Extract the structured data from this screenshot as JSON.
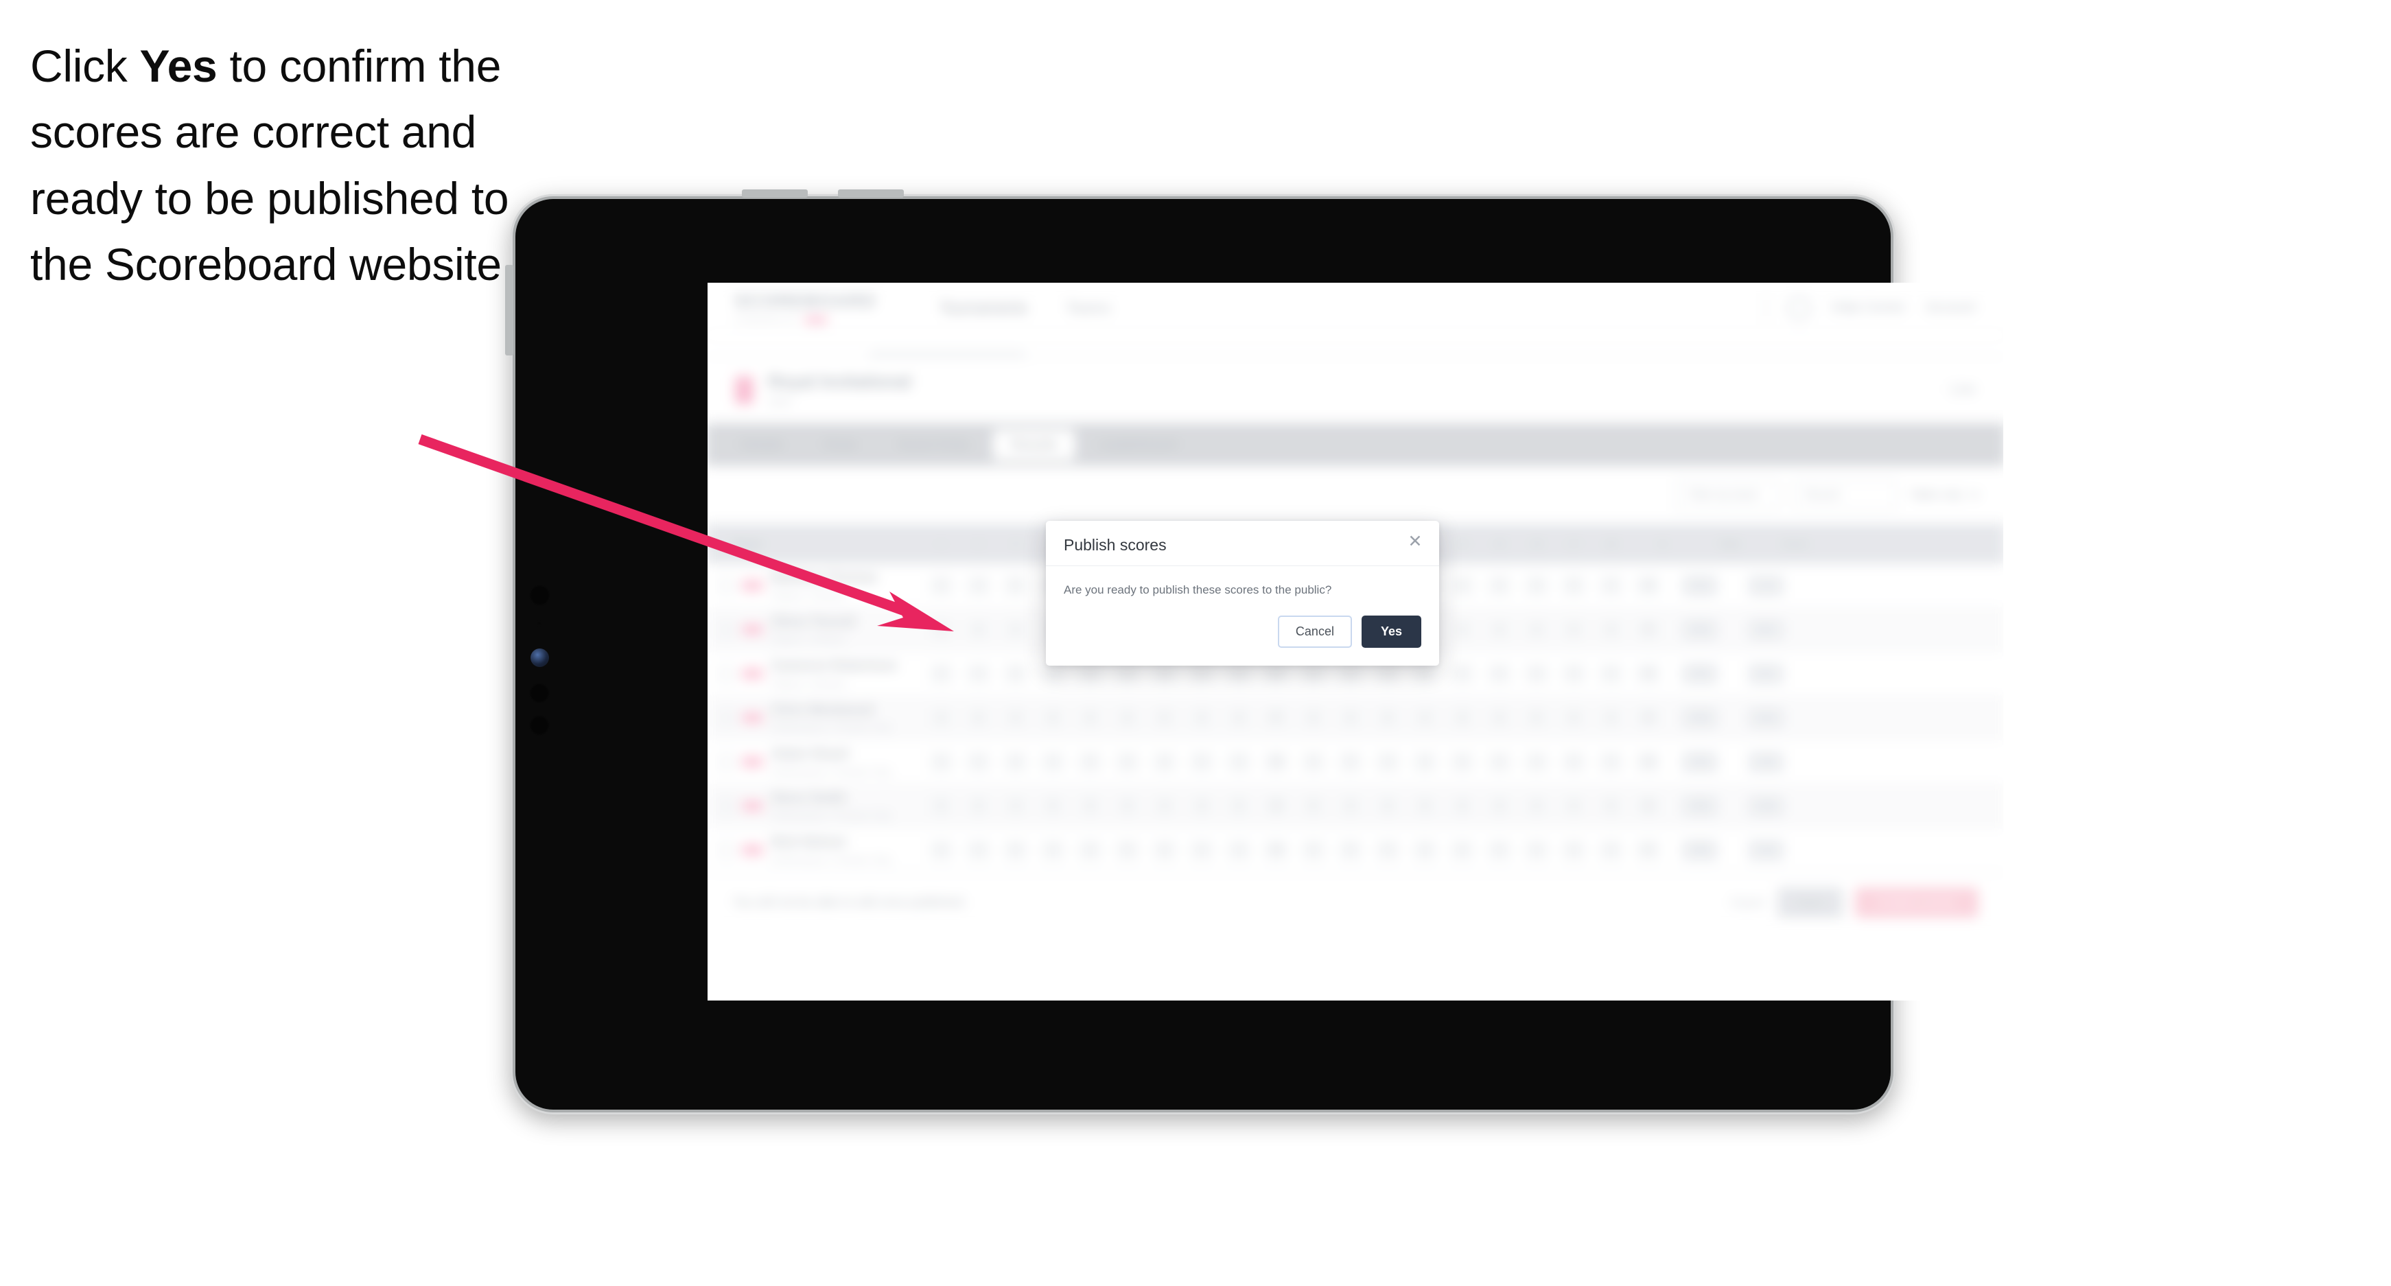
{
  "caption": {
    "lead": "Click ",
    "emphasis": "Yes",
    "rest": " to confirm the scores are correct and ready to be published to the Scoreboard website."
  },
  "colors": {
    "accent_pink": "#e8255f",
    "brand_pink": "#f9b9cf",
    "primary_dark": "#2b3648",
    "cancel_border": "#c9d8ef",
    "tablet_bezel": "#0a0a0a",
    "tablet_frame": "#a9acad"
  },
  "device": {
    "type": "tablet",
    "orientation": "landscape"
  },
  "app": {
    "brand": {
      "wordmark": "SCOREBOARD",
      "tagline": "POWERED BY",
      "tagline_badge": ""
    },
    "topnav": [
      {
        "label": "Tournaments"
      },
      {
        "label": "Teams"
      }
    ],
    "topbar_right": {
      "icon": "bell-icon",
      "links": [
        {
          "label": "Help Centre"
        },
        {
          "label": "Account"
        }
      ]
    },
    "title_row": {
      "badge": "",
      "title": "Royal Invitational",
      "subtitle": "2024",
      "right_label": "Live"
    },
    "tabs": [
      {
        "label": "Details",
        "active": false
      },
      {
        "label": "Draw",
        "active": false
      },
      {
        "label": "Score Entry",
        "active": false
      },
      {
        "label": "Results",
        "active": true
      },
      {
        "label": "Leaderboard",
        "active": false
      }
    ],
    "filters": [
      {
        "type": "select",
        "label": "Filter by team"
      },
      {
        "type": "select",
        "label": "Round"
      },
      {
        "type": "text",
        "label": "Table only",
        "icon": "chevron-down-icon"
      }
    ],
    "table": {
      "columns": [
        "Player",
        "1",
        "2",
        "3",
        "4",
        "5",
        "6",
        "7",
        "8",
        "9",
        "Out",
        "10",
        "11",
        "12",
        "13",
        "14",
        "15",
        "16",
        "17",
        "18",
        "In",
        "Total",
        "Score"
      ],
      "rows": [
        {
          "badge": "",
          "name": "Matthew Thomas",
          "sub": "Players • Division",
          "scores": [
            "4",
            "4",
            "5",
            "3",
            "4",
            "4",
            "3",
            "5",
            "4"
          ],
          "out": "36",
          "in": "35",
          "total": "71",
          "score": "-1"
        },
        {
          "badge": "",
          "name": "Oliver Parnell",
          "sub": "Players • Division",
          "scores": [
            "5",
            "4",
            "4",
            "4",
            "3",
            "4",
            "4",
            "4",
            "4"
          ],
          "out": "36",
          "in": "36",
          "total": "72",
          "score": "E"
        },
        {
          "badge": "",
          "name": "Cameron Robertson",
          "sub": "Players • Division",
          "scores": [
            "4",
            "5",
            "4",
            "3",
            "4",
            "5",
            "4",
            "4",
            "4"
          ],
          "out": "37",
          "in": "35",
          "total": "72",
          "score": "E"
        },
        {
          "badge": "",
          "name": "Chris Westwood",
          "sub": "Performance • Premier Only",
          "scores": [
            "4",
            "4",
            "4",
            "4",
            "4",
            "4",
            "5",
            "4",
            "4"
          ],
          "out": "37",
          "in": "36",
          "total": "73",
          "score": "+1"
        },
        {
          "badge": "",
          "name": "Adam Stuart",
          "sub": "Performance • Premier Only",
          "scores": [
            "4",
            "5",
            "4",
            "4",
            "4",
            "4",
            "4",
            "5",
            "4"
          ],
          "out": "38",
          "in": "36",
          "total": "74",
          "score": "+2"
        },
        {
          "badge": "",
          "name": "Steve Smith",
          "sub": "Performance • Premier Only",
          "scores": [
            "5",
            "4",
            "4",
            "5",
            "4",
            "4",
            "4",
            "4",
            "5"
          ],
          "out": "39",
          "in": "36",
          "total": "75",
          "score": "+3"
        },
        {
          "badge": "",
          "name": "Nick Nelson",
          "sub": "Performance • Premier Only",
          "scores": [
            "4",
            "5",
            "5",
            "4",
            "4",
            "5",
            "4",
            "4",
            "4"
          ],
          "out": "39",
          "in": "37",
          "total": "76",
          "score": "+4"
        }
      ]
    },
    "bottom_bar": {
      "note": "You will not be able to edit once published.",
      "link": "Export",
      "secondary_button": "Save",
      "primary_button": "Publish scores"
    }
  },
  "modal": {
    "title": "Publish scores",
    "close_icon": "close-icon",
    "body": "Are you ready to publish these scores to the public?",
    "cancel_label": "Cancel",
    "confirm_label": "Yes"
  },
  "annotation": {
    "arrow": "arrow-pointing-to-yes-button"
  }
}
